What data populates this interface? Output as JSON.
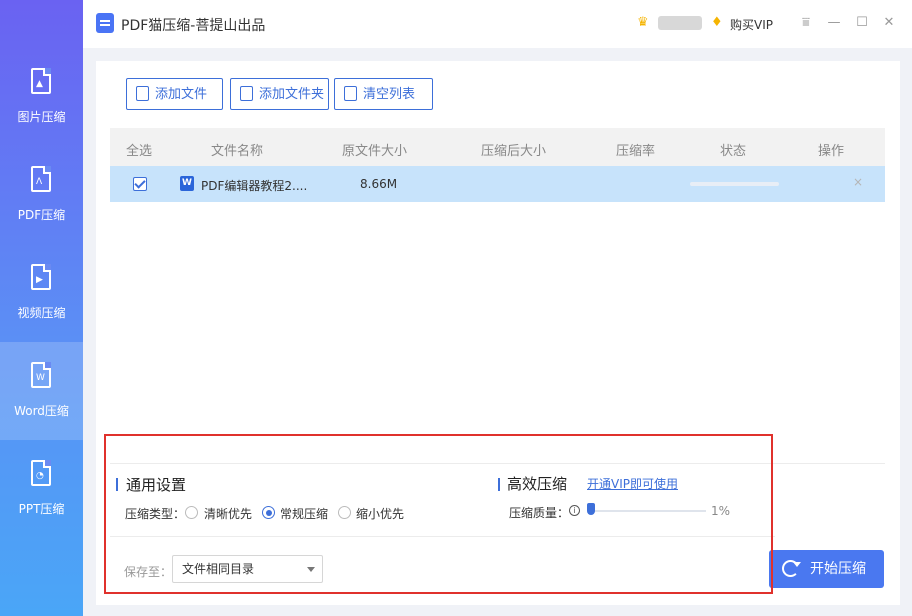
{
  "titlebar": {
    "title": "PDF猫压缩-菩提山出品",
    "crown_icon": "crown-icon",
    "vip_label": "购买VIP",
    "menu_glyph": "⩸",
    "min_glyph": "—",
    "max_glyph": "☐",
    "close_glyph": "✕"
  },
  "sidebar": {
    "items": [
      {
        "label": "图片压缩",
        "icon": "image-file-icon",
        "glyph": "▲"
      },
      {
        "label": "PDF压缩",
        "icon": "pdf-file-icon",
        "glyph": "ᐱ"
      },
      {
        "label": "视频压缩",
        "icon": "video-file-icon",
        "glyph": "▶"
      },
      {
        "label": "Word压缩",
        "icon": "word-file-icon",
        "glyph": "W",
        "active": true
      },
      {
        "label": "PPT压缩",
        "icon": "ppt-file-icon",
        "glyph": "◔"
      }
    ]
  },
  "toolbar": {
    "add_file": "添加文件",
    "add_folder": "添加文件夹",
    "clear_list": "清空列表"
  },
  "table": {
    "columns": [
      "全选",
      "文件名称",
      "原文件大小",
      "压缩后大小",
      "压缩率",
      "状态",
      "操作"
    ],
    "rows": [
      {
        "name": "PDF编辑器教程2....",
        "original_size": "8.66M",
        "compressed_size": "",
        "ratio": "",
        "progress": 0,
        "delete_glyph": "×"
      }
    ]
  },
  "settings": {
    "general_title": "通用设置",
    "type_label": "压缩类型：",
    "options": [
      "清晰优先",
      "常规压缩",
      "缩小优先"
    ],
    "selected_option": "常规压缩",
    "advanced_title": "高效压缩",
    "vip_link": "开通VIP即可使用",
    "quality_label": "压缩质量：",
    "quality_value": "1%",
    "quality_level": 0.01,
    "save_label": "保存至：",
    "save_value": "文件相同目录"
  },
  "start_button": "开始压缩",
  "colors": {
    "accent": "#3d6fd9",
    "row_selected": "#c7e3fb",
    "highlight": "#e0312c"
  }
}
